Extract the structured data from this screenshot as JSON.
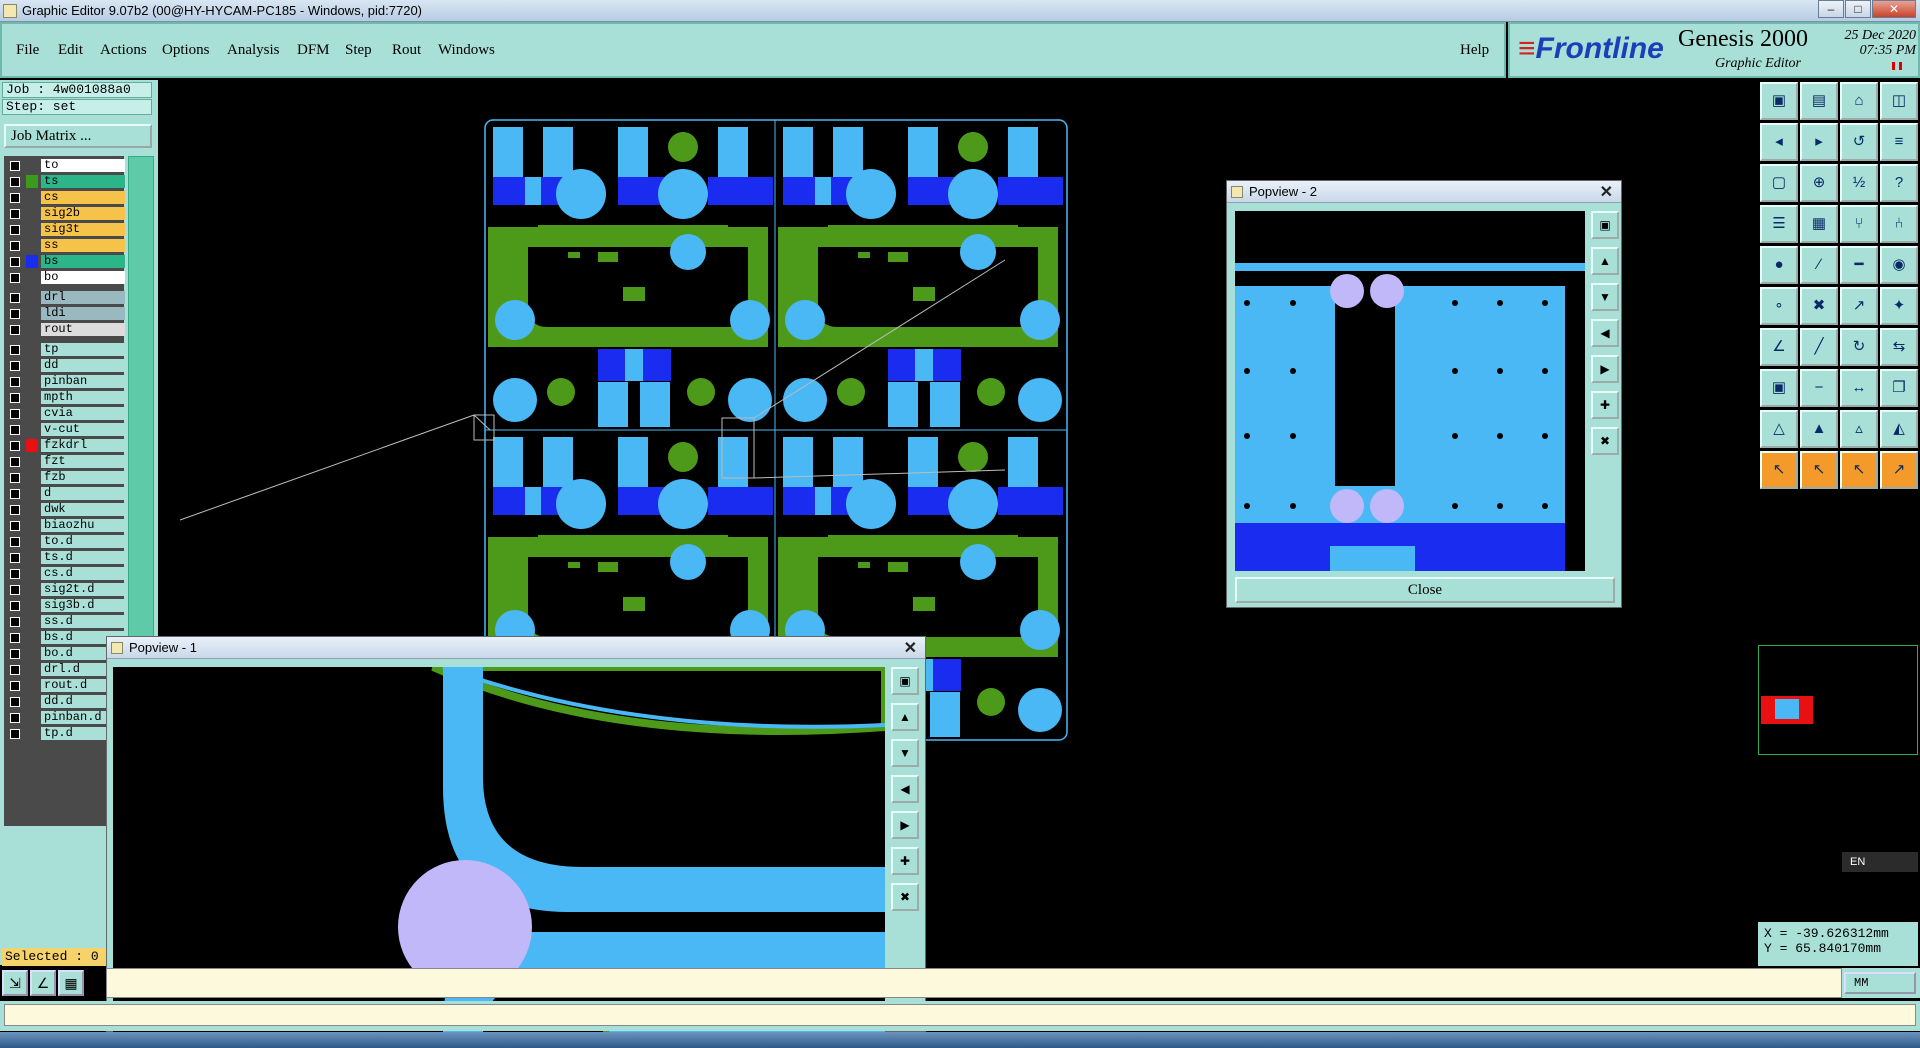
{
  "window": {
    "title": "Graphic Editor 9.07b2 (00@HY-HYCAM-PC185 - Windows, pid:7720)",
    "min": "–",
    "max": "□",
    "close": "✕"
  },
  "menu": {
    "file": "File",
    "edit": "Edit",
    "actions": "Actions",
    "options": "Options",
    "analysis": "Analysis",
    "dfm": "DFM",
    "step": "Step",
    "rout": "Rout",
    "windows": "Windows",
    "help": "Help"
  },
  "brand": {
    "logo_a": "≡",
    "logo_b": "Frontline",
    "product": "Genesis 2000",
    "subtitle": "Graphic Editor",
    "date": "25 Dec 2020",
    "time": "07:35 PM"
  },
  "job": {
    "job_line": "Job : 4w001088a0",
    "step_line": "Step: set",
    "matrix_button": "Job Matrix ..."
  },
  "layers": [
    {
      "name": "to",
      "color": "#ffffff",
      "swatch": ""
    },
    {
      "name": "ts",
      "color": "#2db58a",
      "swatch": "#3a9a1a"
    },
    {
      "name": "cs",
      "color": "#f5c24a",
      "swatch": ""
    },
    {
      "name": "sig2b",
      "color": "#f5c24a",
      "swatch": ""
    },
    {
      "name": "sig3t",
      "color": "#f5c24a",
      "swatch": ""
    },
    {
      "name": "ss",
      "color": "#f5c24a",
      "swatch": ""
    },
    {
      "name": "bs",
      "color": "#2db58a",
      "swatch": "#1a2cf0"
    },
    {
      "name": "bo",
      "color": "#ffffff",
      "swatch": ""
    },
    {
      "name": "drl",
      "color": "#9ab8c0",
      "swatch": ""
    },
    {
      "name": "ldi",
      "color": "#9ab8c0",
      "swatch": ""
    },
    {
      "name": "rout",
      "color": "#dcdcdc",
      "swatch": ""
    },
    {
      "name": "tp",
      "color": "#a8e0d8",
      "swatch": ""
    },
    {
      "name": "dd",
      "color": "#a8e0d8",
      "swatch": ""
    },
    {
      "name": "pinban",
      "color": "#a8e0d8",
      "swatch": ""
    },
    {
      "name": "mpth",
      "color": "#a8e0d8",
      "swatch": ""
    },
    {
      "name": "cvia",
      "color": "#a8e0d8",
      "swatch": ""
    },
    {
      "name": "v-cut",
      "color": "#a8e0d8",
      "swatch": ""
    },
    {
      "name": "fzkdrl",
      "color": "#a8e0d8",
      "swatch": "#e81010"
    },
    {
      "name": "fzt",
      "color": "#a8e0d8",
      "swatch": ""
    },
    {
      "name": "fzb",
      "color": "#a8e0d8",
      "swatch": ""
    },
    {
      "name": "d",
      "color": "#a8e0d8",
      "swatch": ""
    },
    {
      "name": "dwk",
      "color": "#a8e0d8",
      "swatch": ""
    },
    {
      "name": "biaozhu",
      "color": "#a8e0d8",
      "swatch": ""
    },
    {
      "name": "to.d",
      "color": "#a8e0d8",
      "swatch": ""
    },
    {
      "name": "ts.d",
      "color": "#a8e0d8",
      "swatch": ""
    },
    {
      "name": "cs.d",
      "color": "#a8e0d8",
      "swatch": ""
    },
    {
      "name": "sig2t.d",
      "color": "#a8e0d8",
      "swatch": ""
    },
    {
      "name": "sig3b.d",
      "color": "#a8e0d8",
      "swatch": ""
    },
    {
      "name": "ss.d",
      "color": "#a8e0d8",
      "swatch": ""
    },
    {
      "name": "bs.d",
      "color": "#a8e0d8",
      "swatch": ""
    },
    {
      "name": "bo.d",
      "color": "#a8e0d8",
      "swatch": ""
    },
    {
      "name": "drl.d",
      "color": "#a8e0d8",
      "swatch": ""
    },
    {
      "name": "rout.d",
      "color": "#a8e0d8",
      "swatch": ""
    },
    {
      "name": "dd.d",
      "color": "#a8e0d8",
      "swatch": ""
    },
    {
      "name": "pinban.d",
      "color": "#a8e0d8",
      "swatch": ""
    },
    {
      "name": "tp.d",
      "color": "#a8e0d8",
      "swatch": ""
    }
  ],
  "status": {
    "selected": "Selected : 0",
    "units": "MM",
    "coord_x": "X = -39.626312mm",
    "coord_y": "Y = 65.840170mm",
    "ime": "EN"
  },
  "popview1": {
    "title": "Popview - 1",
    "close_x": "✕"
  },
  "popview2": {
    "title": "Popview - 2",
    "close_x": "✕",
    "close_button": "Close"
  },
  "colors": {
    "panel": "#a8e0d8",
    "pad": "#4ab8f5",
    "copper": "#4d9a1a",
    "blue": "#1a2cf0",
    "lilac": "#c0b8f8",
    "background": "#000000"
  }
}
